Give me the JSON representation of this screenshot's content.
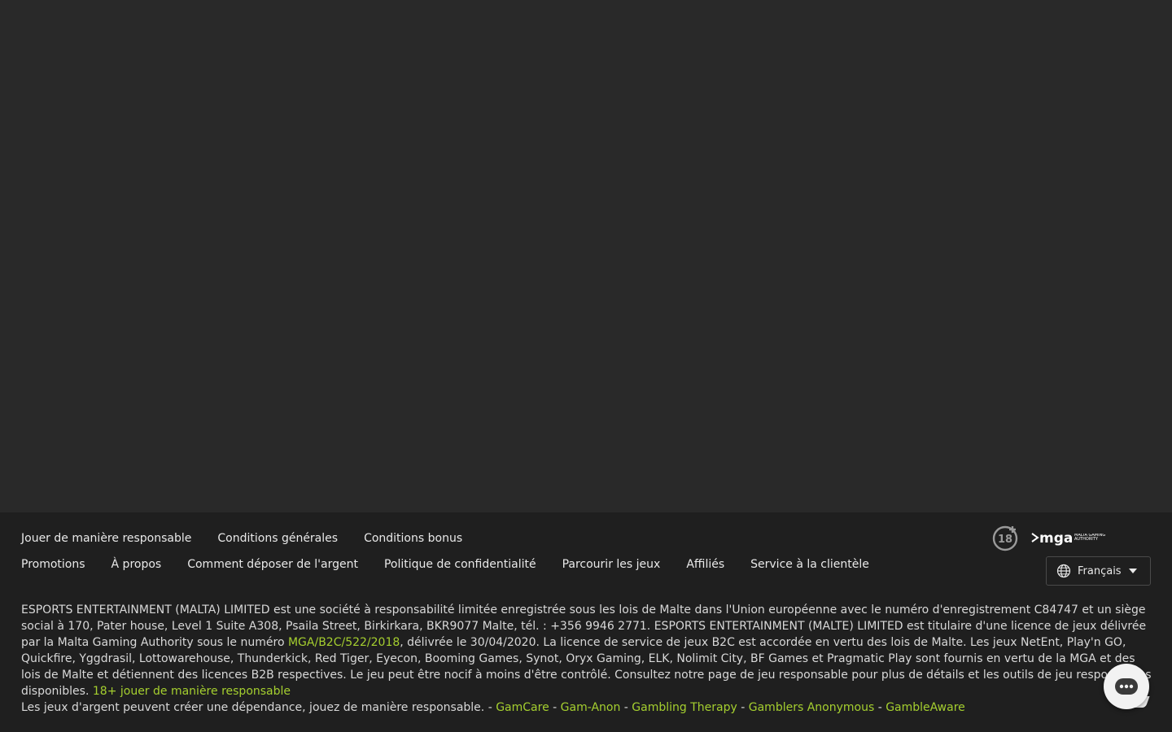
{
  "footer": {
    "nav_row1": [
      {
        "label": "Jouer de manière responsable"
      },
      {
        "label": "Conditions générales"
      },
      {
        "label": "Conditions bonus"
      }
    ],
    "nav_row2": [
      {
        "label": "Promotions"
      },
      {
        "label": "À propos"
      },
      {
        "label": "Comment déposer de l'argent"
      },
      {
        "label": "Politique de confidentialité"
      },
      {
        "label": "Parcourir les jeux"
      },
      {
        "label": "Affiliés"
      },
      {
        "label": "Service à la clientèle"
      }
    ],
    "age_badge": "18",
    "mga_logo": {
      "text": "mga",
      "subtext": "MALTA GAMING AUTHORITY"
    },
    "language": {
      "selected": "Français",
      "icon": "globe-icon"
    },
    "legal": {
      "text1": "ESPORTS ENTERTAINMENT (MALTA) LIMITED est une société à responsabilité limitée enregistrée sous les lois de Malte dans l'Union européenne avec le numéro d'enregistrement C84747 et un siège social à 170, Pater house, Level 1 Suite A308, Psaila Street, Birkirkara, BKR9077 Malte, tél. : +356 9946 2771. ESPORTS ENTERTAINMENT (MALTE) LIMITED est titulaire d'une licence de jeux délivrée par la Malta Gaming Authority sous le numéro ",
      "license_link": "MGA/B2C/522/2018",
      "text2": ", délivrée le 30/04/2020. La licence de service de jeux B2C est accordée en vertu des lois de Malte. Les jeux NetEnt, Play'n GO, Quickfire, Yggdrasil, Lottowarehouse, Thunderkick, Red Tiger, Eyecon, Booming Games, Synot, Oryx Gaming, ELK, Nolimit City, BF Games et Pragmatic Play sont fournis en vertu de la MGA et des lois de Malte et détiennent des licences B2B respectives. Le jeu peut être nocif à moins d'être contrôlé. Consultez notre page de jeu responsable pour plus de détails et les outils de jeu responsables disponibles. ",
      "responsible_link": "18+ jouer de manière responsable",
      "addiction_text": "Les jeux d'argent peuvent créer une dépendance, jouez de manière responsable. - ",
      "help_links": [
        "GamCare",
        "Gam-Anon",
        "Gambling Therapy",
        "Gamblers Anonymous",
        "GambleAware"
      ],
      "separator": " - "
    }
  },
  "chat": {
    "icon": "chat-bubble-icon"
  },
  "colors": {
    "background": "#292929",
    "footer": "#1f1f1f",
    "link_accent": "#a5cf2f",
    "text": "#e9e9e9"
  }
}
